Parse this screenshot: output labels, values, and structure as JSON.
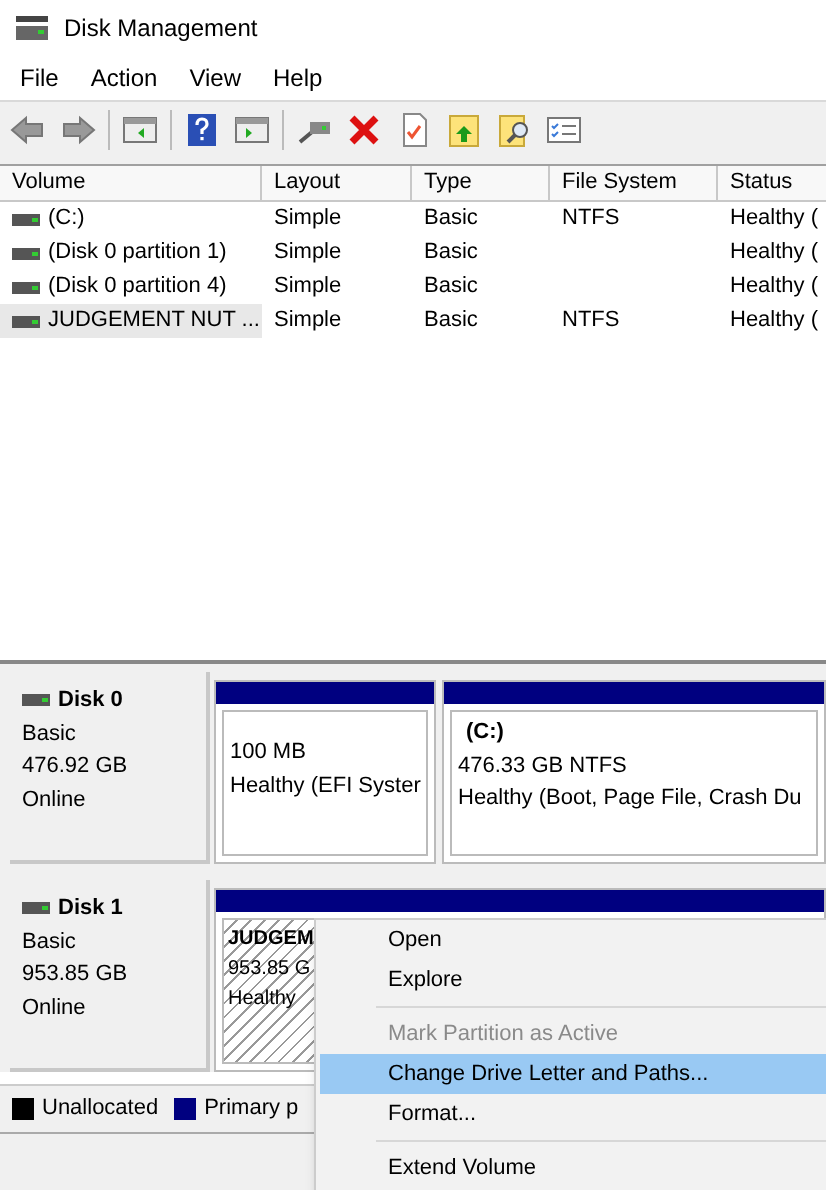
{
  "window": {
    "title": "Disk Management"
  },
  "menu_bar": [
    "File",
    "Action",
    "View",
    "Help"
  ],
  "table": {
    "columns": [
      "Volume",
      "Layout",
      "Type",
      "File System",
      "Status"
    ],
    "rows": [
      {
        "cells": [
          "(C:)",
          "Simple",
          "Basic",
          "NTFS",
          "Healthy ("
        ],
        "selected": false
      },
      {
        "cells": [
          "(Disk 0 partition 1)",
          "Simple",
          "Basic",
          "",
          "Healthy ("
        ],
        "selected": false
      },
      {
        "cells": [
          "(Disk 0 partition 4)",
          "Simple",
          "Basic",
          "",
          "Healthy ("
        ],
        "selected": false
      },
      {
        "cells": [
          "JUDGEMENT NUT ...",
          "Simple",
          "Basic",
          "NTFS",
          "Healthy ("
        ],
        "selected": true
      }
    ]
  },
  "disks": [
    {
      "name": "Disk 0",
      "type": "Basic",
      "size": "476.92 GB",
      "status": "Online",
      "partitions": [
        {
          "size": "100 MB",
          "status": "Healthy (EFI Syster",
          "selected": false
        },
        {
          "title": "(C:)",
          "size": "476.33 GB NTFS",
          "status": "Healthy (Boot, Page File, Crash Du",
          "selected": false
        }
      ]
    },
    {
      "name": "Disk 1",
      "type": "Basic",
      "size": "953.85 GB",
      "status": "Online",
      "partitions": [
        {
          "title": "JUDGEM",
          "size": "953.85 G",
          "status": "Healthy",
          "selected": true
        }
      ]
    }
  ],
  "legend": [
    {
      "label": "Unallocated",
      "color": "#000000"
    },
    {
      "label": "Primary p",
      "color": "#000080"
    }
  ],
  "context_menu": [
    {
      "label": "Open",
      "disabled": false,
      "selected": false
    },
    {
      "label": "Explore",
      "disabled": false,
      "selected": false
    },
    {
      "kind": "separator"
    },
    {
      "label": "Mark Partition as Active",
      "disabled": true,
      "selected": false
    },
    {
      "label": "Change Drive Letter and Paths...",
      "disabled": false,
      "selected": true
    },
    {
      "label": "Format...",
      "disabled": false,
      "selected": false
    },
    {
      "kind": "separator"
    },
    {
      "label": "Extend Volume",
      "disabled": false,
      "selected": false
    }
  ]
}
